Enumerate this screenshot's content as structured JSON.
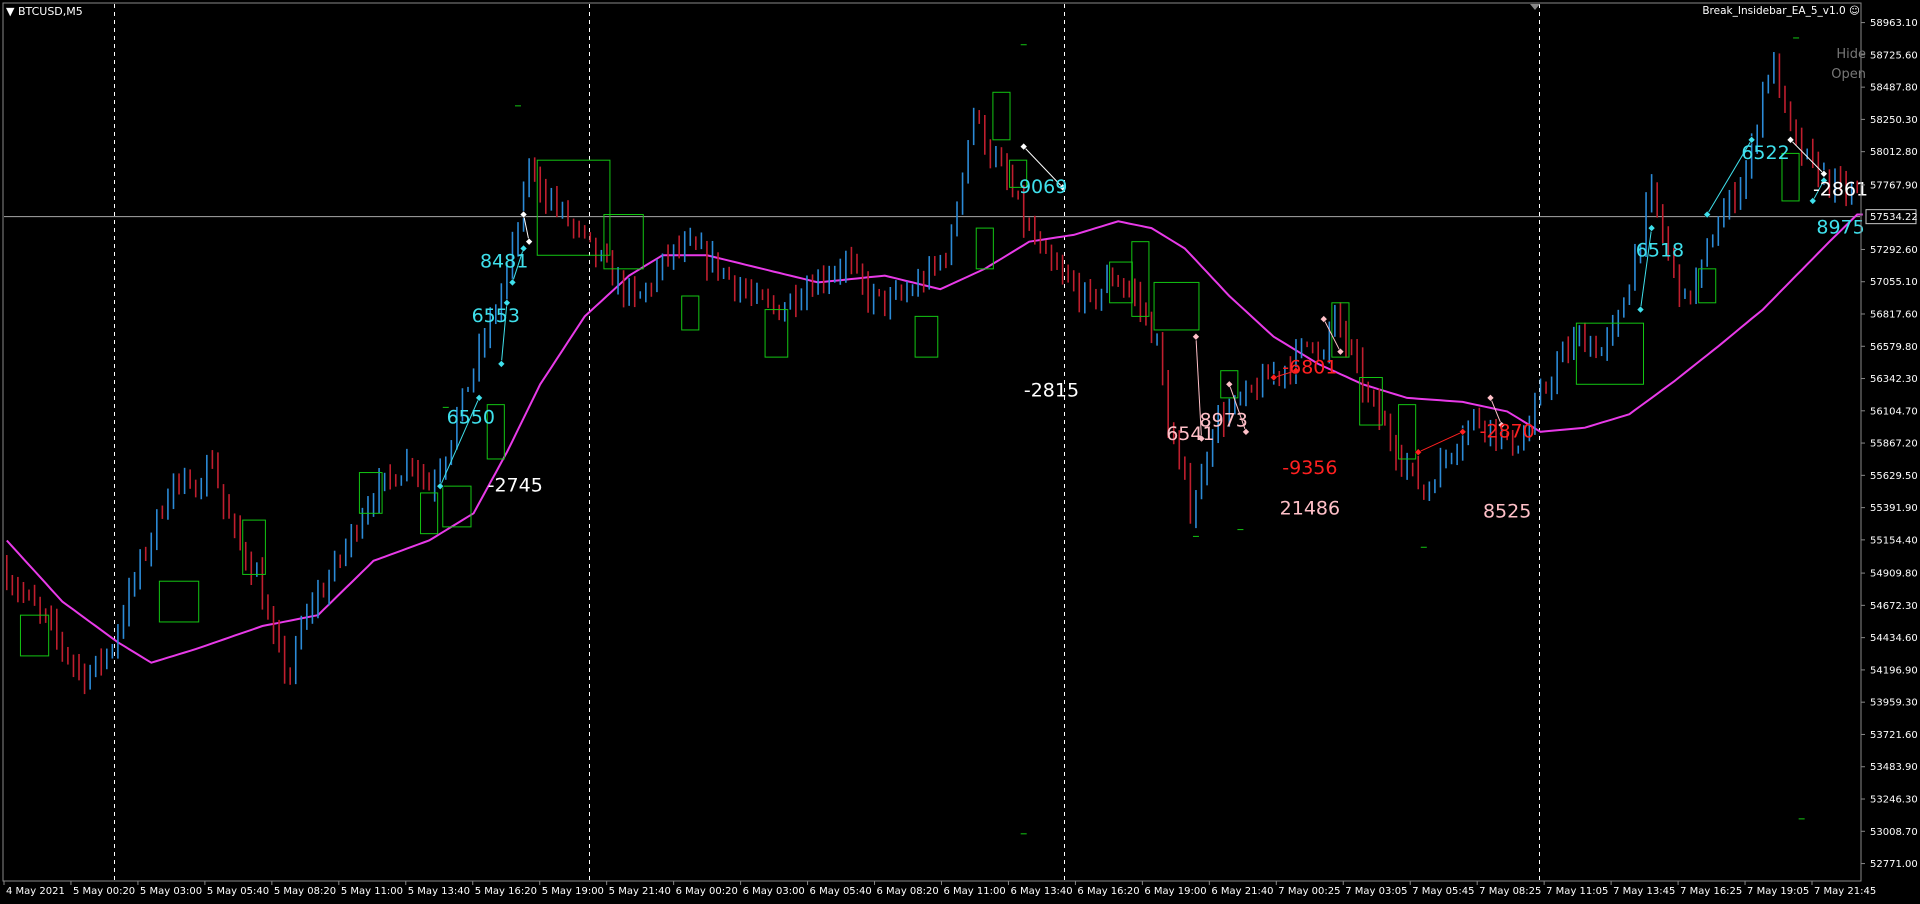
{
  "window": {
    "symbol": "BTCUSD,M5",
    "ea_name": "Break_Insidebar_EA_5_v1.0",
    "smile_icon": "smile-icon",
    "hide_label": "Hide",
    "open_label": "Open"
  },
  "colors": {
    "background": "#000000",
    "bull": "#2b8ad6",
    "bear": "#c01e2e",
    "ma": "#e83ae8",
    "box": "#13c613",
    "grid": "#ffffff",
    "axis_text": "#ffffff",
    "label_cyan": "#3fe0ec",
    "label_white": "#ffffff",
    "label_pink": "#ffc0c8",
    "label_red": "#ff2020"
  },
  "chart_data": {
    "type": "candlestick",
    "symbol": "BTCUSD",
    "timeframe": "M5",
    "ylim": [
      52650,
      59100
    ],
    "price_ticks": [
      "58963.10",
      "58725.60",
      "58487.80",
      "58250.30",
      "58012.80",
      "57767.90",
      "57292.60",
      "57055.10",
      "56817.60",
      "56579.80",
      "56342.30",
      "56104.70",
      "55867.20",
      "55629.50",
      "55391.90",
      "55154.40",
      "54909.80",
      "54672.30",
      "54434.60",
      "54196.90",
      "53959.30",
      "53721.60",
      "53483.90",
      "53246.30",
      "53008.70",
      "52771.00"
    ],
    "current_price": "57534.22",
    "time_labels": [
      "4 May 2021",
      "5 May 00:20",
      "5 May 03:00",
      "5 May 05:40",
      "5 May 08:20",
      "5 May 11:00",
      "5 May 13:40",
      "5 May 16:20",
      "5 May 19:00",
      "5 May 21:40",
      "6 May 00:20",
      "6 May 03:00",
      "6 May 05:40",
      "6 May 08:20",
      "6 May 11:00",
      "6 May 13:40",
      "6 May 16:20",
      "6 May 19:00",
      "6 May 21:40",
      "7 May 00:25",
      "7 May 03:05",
      "7 May 05:45",
      "7 May 08:25",
      "7 May 11:05",
      "7 May 13:45",
      "7 May 16:25",
      "7 May 19:05",
      "7 May 21:45"
    ],
    "day_separators": [
      "5 May 00:00",
      "6 May 00:00",
      "7 May 00:00",
      "8 May 00:00"
    ],
    "trend_path": [
      [
        0,
        54950
      ],
      [
        3,
        54800
      ],
      [
        8,
        54550
      ],
      [
        12,
        54300
      ],
      [
        15,
        54150
      ],
      [
        17,
        54220
      ],
      [
        20,
        54380
      ],
      [
        23,
        54750
      ],
      [
        28,
        55300
      ],
      [
        31,
        55600
      ],
      [
        34,
        55500
      ],
      [
        38,
        55750
      ],
      [
        40,
        55400
      ],
      [
        43,
        55100
      ],
      [
        46,
        54900
      ],
      [
        48,
        54550
      ],
      [
        50,
        54300
      ],
      [
        52,
        54150
      ],
      [
        54,
        54500
      ],
      [
        56,
        54700
      ],
      [
        58,
        54800
      ],
      [
        62,
        55100
      ],
      [
        66,
        55450
      ],
      [
        70,
        55600
      ],
      [
        74,
        55750
      ],
      [
        77,
        55550
      ],
      [
        80,
        55800
      ],
      [
        84,
        56300
      ],
      [
        88,
        56750
      ],
      [
        91,
        57100
      ],
      [
        93,
        57450
      ],
      [
        95,
        57900
      ],
      [
        98,
        57700
      ],
      [
        102,
        57500
      ],
      [
        106,
        57300
      ],
      [
        110,
        57100
      ],
      [
        114,
        56900
      ],
      [
        117,
        57050
      ],
      [
        120,
        57250
      ],
      [
        124,
        57300
      ],
      [
        128,
        57200
      ],
      [
        132,
        57050
      ],
      [
        136,
        56900
      ],
      [
        140,
        56850
      ],
      [
        144,
        57000
      ],
      [
        148,
        57100
      ],
      [
        152,
        57200
      ],
      [
        156,
        56950
      ],
      [
        160,
        56900
      ],
      [
        164,
        57000
      ],
      [
        168,
        57150
      ],
      [
        171,
        57350
      ],
      [
        173,
        57900
      ],
      [
        175,
        58300
      ],
      [
        178,
        58000
      ],
      [
        181,
        57800
      ],
      [
        184,
        57500
      ],
      [
        188,
        57200
      ],
      [
        192,
        57050
      ],
      [
        196,
        56900
      ],
      [
        200,
        57100
      ],
      [
        204,
        56950
      ],
      [
        208,
        56600
      ],
      [
        210,
        56000
      ],
      [
        212,
        55700
      ],
      [
        214,
        55400
      ],
      [
        216,
        55600
      ],
      [
        218,
        56000
      ],
      [
        221,
        56100
      ],
      [
        224,
        56200
      ],
      [
        228,
        56350
      ],
      [
        232,
        56450
      ],
      [
        236,
        56650
      ],
      [
        238,
        56500
      ],
      [
        240,
        56800
      ],
      [
        243,
        56500
      ],
      [
        246,
        56200
      ],
      [
        250,
        55900
      ],
      [
        253,
        55700
      ],
      [
        256,
        55500
      ],
      [
        259,
        55700
      ],
      [
        262,
        55900
      ],
      [
        265,
        56050
      ],
      [
        268,
        56000
      ],
      [
        271,
        55850
      ],
      [
        274,
        55900
      ],
      [
        277,
        56200
      ],
      [
        280,
        56450
      ],
      [
        284,
        56650
      ],
      [
        288,
        56550
      ],
      [
        291,
        56750
      ],
      [
        294,
        57250
      ],
      [
        297,
        57700
      ],
      [
        300,
        57250
      ],
      [
        303,
        56900
      ],
      [
        306,
        57150
      ],
      [
        309,
        57500
      ],
      [
        312,
        57700
      ],
      [
        315,
        58000
      ],
      [
        317,
        58500
      ],
      [
        319,
        58650
      ],
      [
        321,
        58300
      ],
      [
        323,
        58050
      ],
      [
        326,
        57900
      ],
      [
        330,
        57750
      ],
      [
        333,
        57700
      ]
    ],
    "moving_average": [
      [
        0,
        55150
      ],
      [
        10,
        54700
      ],
      [
        20,
        54400
      ],
      [
        26,
        54250
      ],
      [
        34,
        54350
      ],
      [
        46,
        54520
      ],
      [
        56,
        54600
      ],
      [
        66,
        55000
      ],
      [
        76,
        55150
      ],
      [
        84,
        55350
      ],
      [
        90,
        55800
      ],
      [
        96,
        56300
      ],
      [
        104,
        56800
      ],
      [
        112,
        57100
      ],
      [
        118,
        57250
      ],
      [
        126,
        57250
      ],
      [
        136,
        57150
      ],
      [
        146,
        57050
      ],
      [
        158,
        57100
      ],
      [
        168,
        57000
      ],
      [
        176,
        57150
      ],
      [
        184,
        57350
      ],
      [
        192,
        57400
      ],
      [
        200,
        57500
      ],
      [
        206,
        57450
      ],
      [
        212,
        57300
      ],
      [
        220,
        56950
      ],
      [
        228,
        56650
      ],
      [
        236,
        56450
      ],
      [
        244,
        56300
      ],
      [
        252,
        56200
      ],
      [
        262,
        56170
      ],
      [
        270,
        56100
      ],
      [
        276,
        55950
      ],
      [
        284,
        55980
      ],
      [
        292,
        56080
      ],
      [
        300,
        56320
      ],
      [
        308,
        56580
      ],
      [
        316,
        56850
      ],
      [
        322,
        57100
      ],
      [
        328,
        57350
      ],
      [
        333,
        57550
      ]
    ],
    "inside_bar_boxes": [
      {
        "i0": 3,
        "i1": 7,
        "hi": 54600,
        "lo": 54300
      },
      {
        "i0": 28,
        "i1": 34,
        "hi": 54850,
        "lo": 54550
      },
      {
        "i0": 43,
        "i1": 46,
        "hi": 55300,
        "lo": 54900
      },
      {
        "i0": 64,
        "i1": 67,
        "hi": 55650,
        "lo": 55350
      },
      {
        "i0": 75,
        "i1": 77,
        "hi": 55500,
        "lo": 55200
      },
      {
        "i0": 79,
        "i1": 83,
        "hi": 55550,
        "lo": 55250
      },
      {
        "i0": 87,
        "i1": 89,
        "hi": 56150,
        "lo": 55750
      },
      {
        "i0": 96,
        "i1": 108,
        "hi": 57950,
        "lo": 57250
      },
      {
        "i0": 108,
        "i1": 114,
        "hi": 57550,
        "lo": 57150
      },
      {
        "i0": 122,
        "i1": 124,
        "hi": 56950,
        "lo": 56700
      },
      {
        "i0": 137,
        "i1": 140,
        "hi": 56850,
        "lo": 56500
      },
      {
        "i0": 164,
        "i1": 167,
        "hi": 56800,
        "lo": 56500
      },
      {
        "i0": 175,
        "i1": 177,
        "hi": 57450,
        "lo": 57150
      },
      {
        "i0": 178,
        "i1": 180,
        "hi": 58450,
        "lo": 58100
      },
      {
        "i0": 181,
        "i1": 183,
        "hi": 57950,
        "lo": 57750
      },
      {
        "i0": 199,
        "i1": 202,
        "hi": 57200,
        "lo": 56900
      },
      {
        "i0": 203,
        "i1": 205,
        "hi": 57350,
        "lo": 56800
      },
      {
        "i0": 207,
        "i1": 214,
        "hi": 57050,
        "lo": 56700
      },
      {
        "i0": 219,
        "i1": 221,
        "hi": 56400,
        "lo": 56200
      },
      {
        "i0": 239,
        "i1": 241,
        "hi": 56900,
        "lo": 56500
      },
      {
        "i0": 244,
        "i1": 247,
        "hi": 56350,
        "lo": 56000
      },
      {
        "i0": 251,
        "i1": 253,
        "hi": 56150,
        "lo": 55750
      },
      {
        "i0": 283,
        "i1": 294,
        "hi": 56750,
        "lo": 56300
      },
      {
        "i0": 305,
        "i1": 307,
        "hi": 57150,
        "lo": 56900
      },
      {
        "i0": 320,
        "i1": 322,
        "hi": 58000,
        "lo": 57650
      }
    ],
    "trade_lines": [
      {
        "color": "cyan",
        "pts": [
          [
            78,
            55550
          ],
          [
            85,
            56200
          ]
        ]
      },
      {
        "color": "cyan",
        "pts": [
          [
            89,
            56450
          ],
          [
            90,
            56900
          ]
        ]
      },
      {
        "color": "cyan",
        "pts": [
          [
            91,
            57050
          ],
          [
            93,
            57300
          ]
        ]
      },
      {
        "color": "white",
        "pts": [
          [
            93,
            57550
          ],
          [
            94,
            57350
          ]
        ]
      },
      {
        "color": "white",
        "pts": [
          [
            183,
            58050
          ],
          [
            190,
            57750
          ]
        ]
      },
      {
        "color": "pink",
        "pts": [
          [
            214,
            56650
          ],
          [
            215,
            55900
          ]
        ]
      },
      {
        "color": "pink",
        "pts": [
          [
            220,
            56300
          ],
          [
            223,
            55950
          ]
        ]
      },
      {
        "color": "red",
        "pts": [
          [
            228,
            56350
          ],
          [
            232,
            56400
          ]
        ]
      },
      {
        "color": "pink",
        "pts": [
          [
            237,
            56780
          ],
          [
            240,
            56540
          ]
        ]
      },
      {
        "color": "red",
        "pts": [
          [
            254,
            55800
          ],
          [
            262,
            55950
          ]
        ]
      },
      {
        "color": "pink",
        "pts": [
          [
            267,
            56200
          ],
          [
            269,
            56000
          ]
        ]
      },
      {
        "color": "cyan",
        "pts": [
          [
            294,
            56850
          ],
          [
            296,
            57450
          ]
        ]
      },
      {
        "color": "cyan",
        "pts": [
          [
            306,
            57550
          ],
          [
            314,
            58100
          ]
        ]
      },
      {
        "color": "white",
        "pts": [
          [
            321,
            58100
          ],
          [
            327,
            57850
          ]
        ]
      },
      {
        "color": "cyan",
        "pts": [
          [
            325,
            57650
          ],
          [
            327,
            57800
          ]
        ]
      }
    ],
    "annotations": [
      {
        "text": "8481",
        "color": "cyan",
        "i": 89.5,
        "y": 57200
      },
      {
        "text": "6553",
        "color": "cyan",
        "i": 88,
        "y": 56800
      },
      {
        "text": "6550",
        "color": "cyan",
        "i": 83.5,
        "y": 56050
      },
      {
        "text": "-2745",
        "color": "white",
        "i": 91.5,
        "y": 55550
      },
      {
        "text": "9069",
        "color": "cyan",
        "i": 186.5,
        "y": 57750
      },
      {
        "text": "-2815",
        "color": "white",
        "i": 188,
        "y": 56250
      },
      {
        "text": "6541",
        "color": "pink",
        "i": 213,
        "y": 55930
      },
      {
        "text": "8973",
        "color": "pink",
        "i": 219,
        "y": 56030
      },
      {
        "text": "-6801",
        "color": "red",
        "i": 234.5,
        "y": 56420
      },
      {
        "text": "-9356",
        "color": "red",
        "i": 234.5,
        "y": 55680
      },
      {
        "text": "21486",
        "color": "pink",
        "i": 234.5,
        "y": 55380
      },
      {
        "text": "-2870",
        "color": "red",
        "i": 270,
        "y": 55950
      },
      {
        "text": "8525",
        "color": "pink",
        "i": 270,
        "y": 55360
      },
      {
        "text": "6518",
        "color": "cyan",
        "i": 297.5,
        "y": 57280
      },
      {
        "text": "6522",
        "color": "cyan",
        "i": 316.5,
        "y": 58000
      },
      {
        "text": "-2861",
        "color": "white",
        "i": 330,
        "y": 57730
      },
      {
        "text": "8975",
        "color": "cyan",
        "i": 330,
        "y": 57450
      }
    ],
    "dash_markers": [
      {
        "i": 92,
        "y": 58350
      },
      {
        "i": 79,
        "y": 56130
      },
      {
        "i": 183,
        "y": 58800
      },
      {
        "i": 214,
        "y": 55180
      },
      {
        "i": 222,
        "y": 55230
      },
      {
        "i": 255,
        "y": 55100
      },
      {
        "i": 183,
        "y": 52990
      },
      {
        "i": 322,
        "y": 58850
      },
      {
        "i": 323,
        "y": 53100
      }
    ]
  }
}
